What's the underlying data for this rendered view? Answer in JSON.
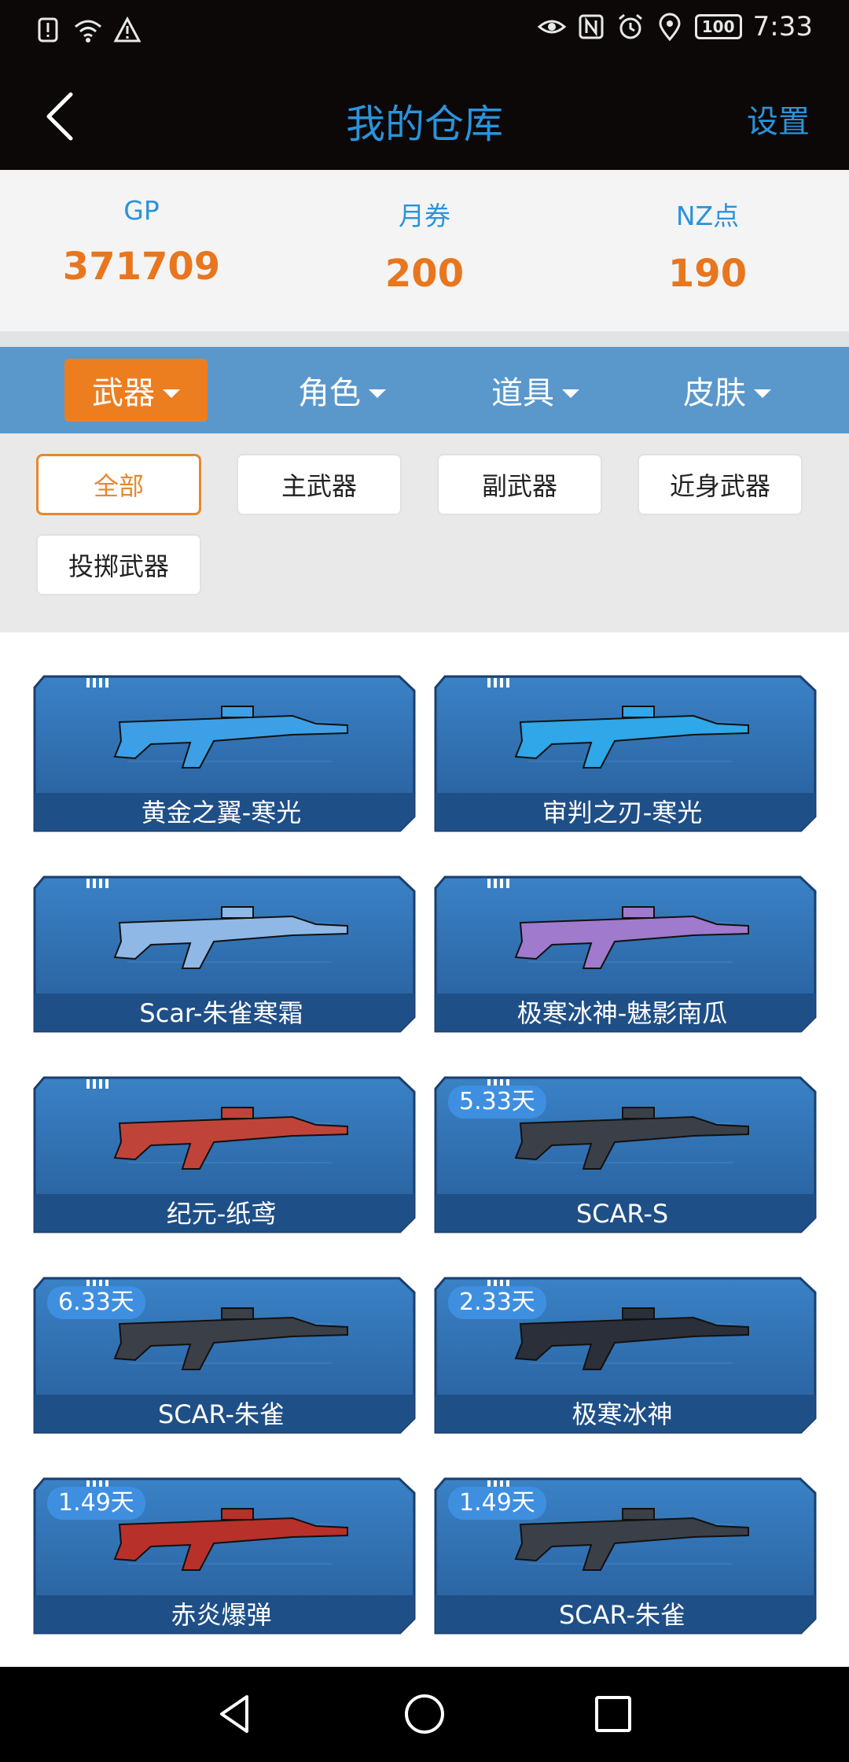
{
  "status_bar": {
    "time": "7:33",
    "battery": "100",
    "left_icons": [
      "alert-icon",
      "wifi-icon",
      "warning-icon"
    ],
    "right_icons": [
      "eye-icon",
      "nfc-icon",
      "alarm-icon",
      "location-icon",
      "battery-icon"
    ]
  },
  "header": {
    "title": "我的仓库",
    "settings_label": "设置",
    "back_icon": "chevron-left-icon"
  },
  "stats": [
    {
      "label": "GP",
      "value": "371709"
    },
    {
      "label": "月券",
      "value": "200"
    },
    {
      "label": "NZ点",
      "value": "190"
    }
  ],
  "categories": [
    {
      "label": "武器",
      "active": true
    },
    {
      "label": "角色",
      "active": false
    },
    {
      "label": "道具",
      "active": false
    },
    {
      "label": "皮肤",
      "active": false
    }
  ],
  "filters": [
    {
      "label": "全部",
      "active": true
    },
    {
      "label": "主武器",
      "active": false
    },
    {
      "label": "副武器",
      "active": false
    },
    {
      "label": "近身武器",
      "active": false
    },
    {
      "label": "投掷武器",
      "active": false
    }
  ],
  "items": [
    {
      "name": "黄金之翼-寒光",
      "badge": ""
    },
    {
      "name": "审判之刃-寒光",
      "badge": ""
    },
    {
      "name": "Scar-朱雀寒霜",
      "badge": ""
    },
    {
      "name": "极寒冰神-魅影南瓜",
      "badge": ""
    },
    {
      "name": "纪元-纸鸢",
      "badge": ""
    },
    {
      "name": "SCAR-S",
      "badge": "5.33天"
    },
    {
      "name": "SCAR-朱雀",
      "badge": "6.33天"
    },
    {
      "name": "极寒冰神",
      "badge": "2.33天"
    },
    {
      "name": "赤炎爆弹",
      "badge": "1.49天"
    },
    {
      "name": "SCAR-朱雀",
      "badge": "1.49天"
    }
  ],
  "colors": {
    "accent_blue": "#2a93dc",
    "accent_orange": "#ed7e20",
    "category_bar": "#5a97cb",
    "card_blue": "#2f6fb3"
  },
  "nav_bar": {
    "icons": [
      "back-triangle-icon",
      "home-circle-icon",
      "recents-square-icon"
    ]
  }
}
